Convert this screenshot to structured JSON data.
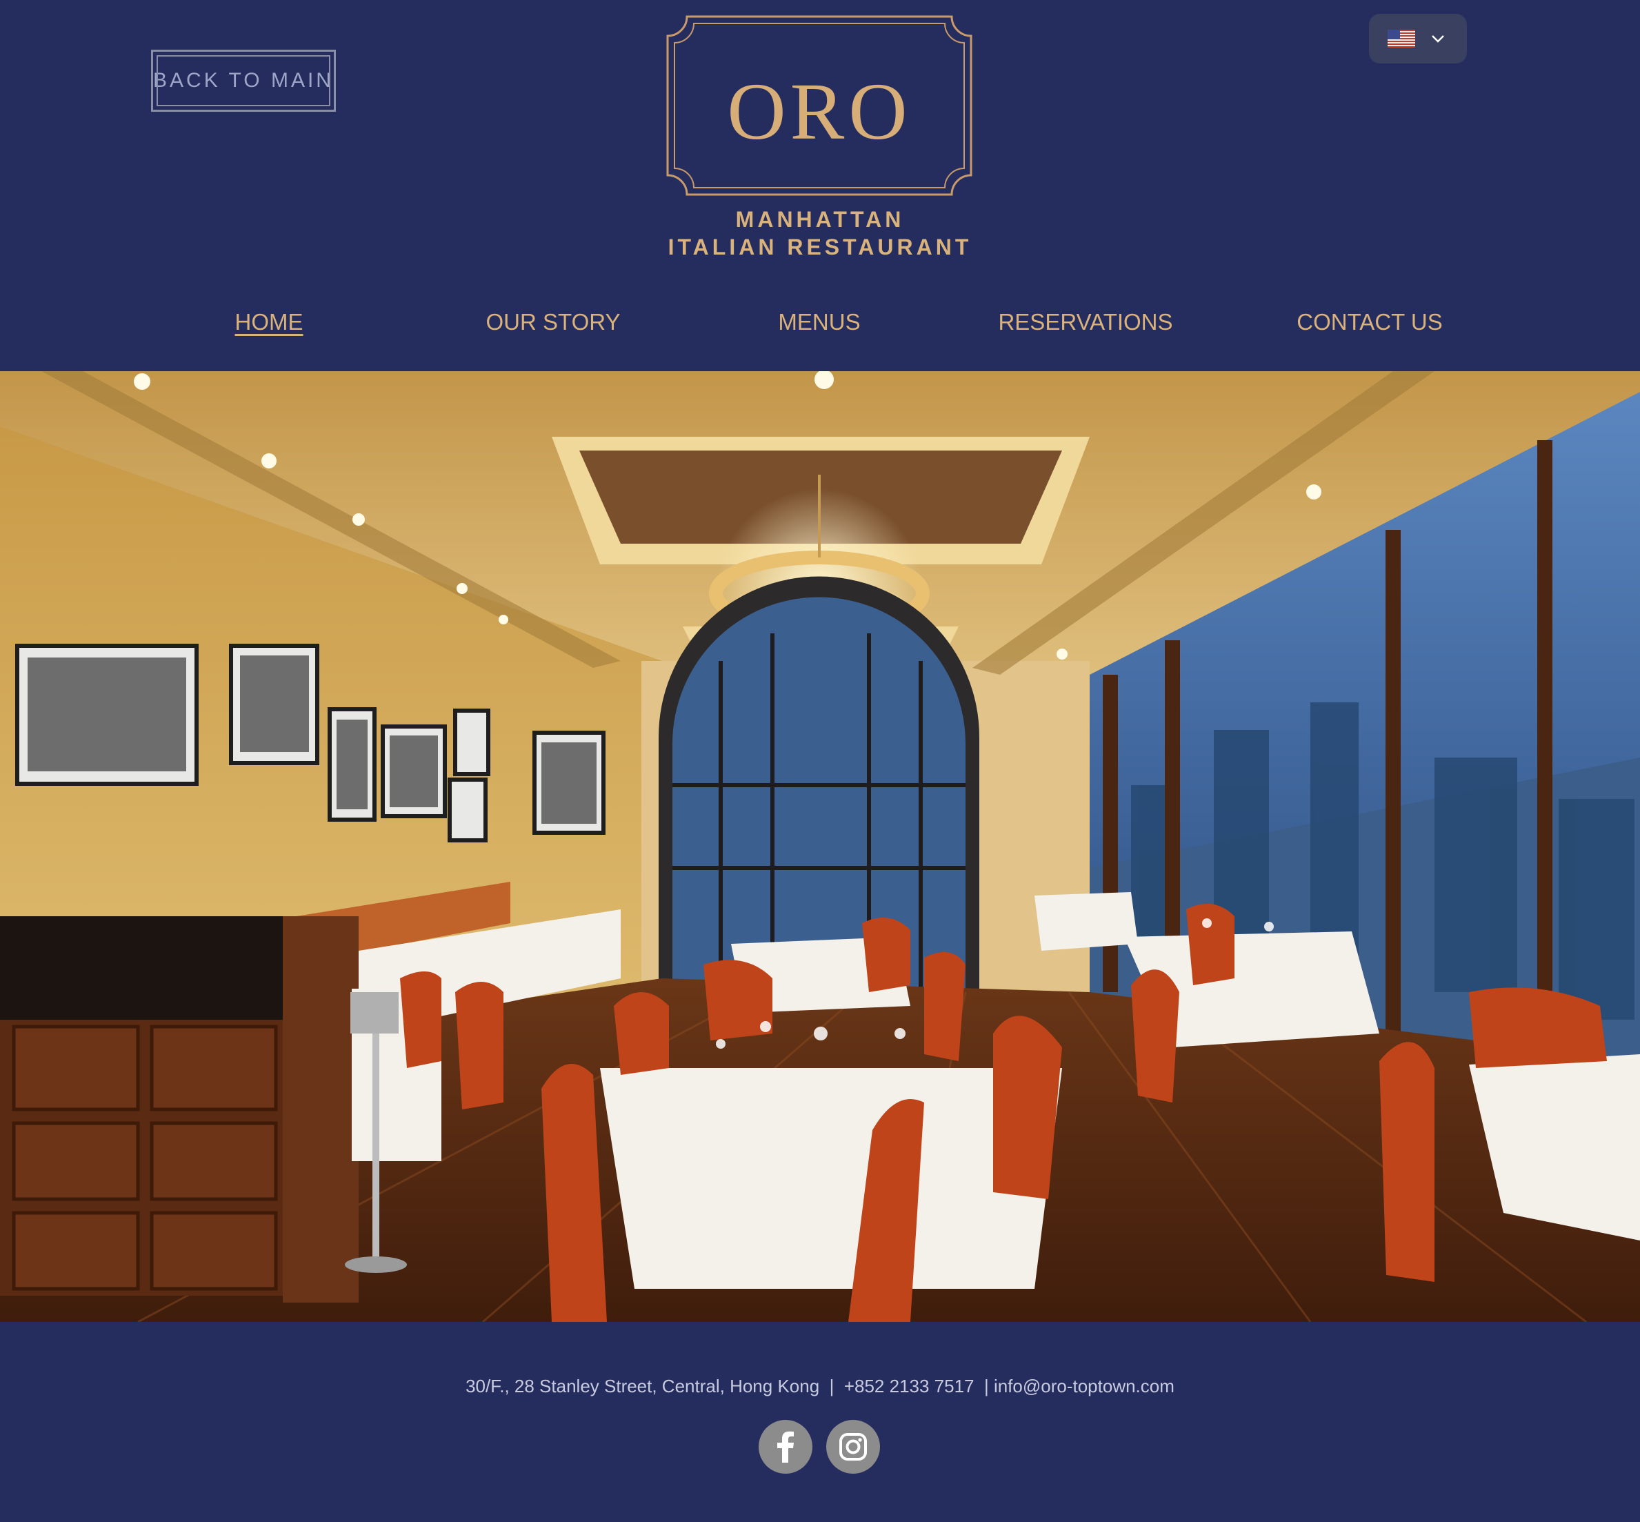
{
  "header": {
    "back_label": "BACK TO MAIN",
    "logo_text": "ORO",
    "tagline_line1": "MANHATTAN",
    "tagline_line2": "ITALIAN RESTAURANT",
    "language_flag": "us-flag-icon"
  },
  "nav": {
    "items": [
      {
        "label": "HOME",
        "active": true
      },
      {
        "label": "OUR STORY",
        "active": false
      },
      {
        "label": "MENUS",
        "active": false
      },
      {
        "label": "RESERVATIONS",
        "active": false
      },
      {
        "label": "CONTACT US",
        "active": false
      }
    ]
  },
  "footer": {
    "info": "30/F., 28 Stanley Street, Central, Hong Kong  |  +852 2133 7517  | info@oro-toptown.com",
    "social": [
      "facebook-icon",
      "instagram-icon"
    ]
  },
  "colors": {
    "background": "#252d5e",
    "gold": "#d9b27c",
    "chair": "#c0441a"
  }
}
